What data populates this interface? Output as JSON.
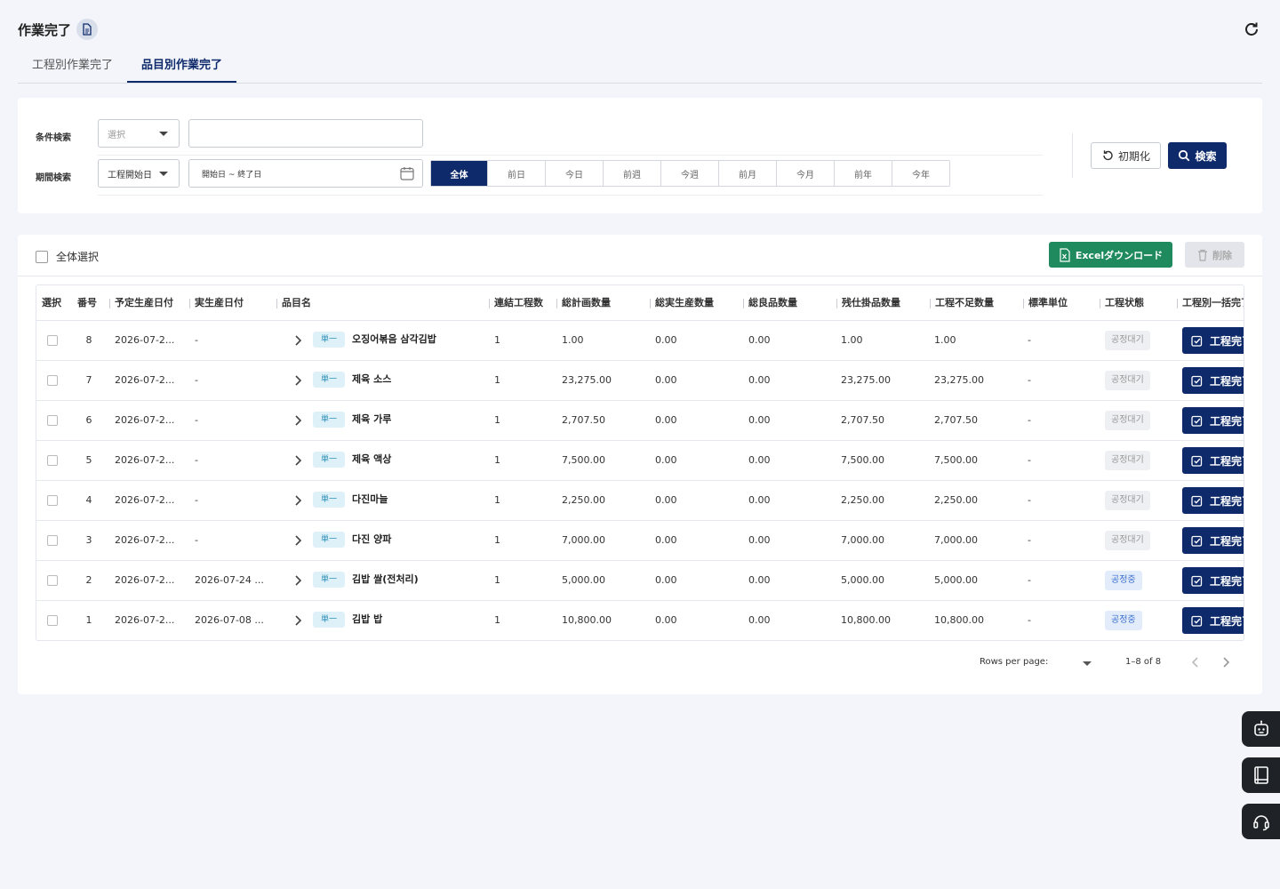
{
  "header": {
    "title": "作業完了"
  },
  "tabs": [
    {
      "label": "工程別作業完了",
      "active": false
    },
    {
      "label": "品目別作業完了",
      "active": true
    }
  ],
  "search": {
    "condition_label": "条件検索",
    "condition_select_placeholder": "選択",
    "condition_input_value": "",
    "period_label": "期間検索",
    "period_select_value": "工程開始日",
    "date_range_placeholder": "開始日 ~ 終了日",
    "period_buttons": [
      "全体",
      "前日",
      "今日",
      "前週",
      "今週",
      "前月",
      "今月",
      "前年",
      "今年"
    ],
    "period_active": "全体",
    "reset_label": "初期化",
    "search_label": "検索"
  },
  "list": {
    "select_all_label": "全体選択",
    "excel_label": "Excelダウンロード",
    "delete_label": "削除",
    "columns": [
      "選択",
      "番号",
      "予定生産日付",
      "実生産日付",
      "品目名",
      "連結工程数",
      "総計画数量",
      "総実生産数量",
      "総良品数量",
      "残仕掛品数量",
      "工程不足数量",
      "標準単位",
      "工程状態",
      "工程別一括完了"
    ],
    "single_tag": "単一",
    "complete_label": "工程完了",
    "rows": [
      {
        "no": "8",
        "planned": "2026-07-2...",
        "actual": "-",
        "item": "오징어볶음 삼각김밥",
        "linked": "1",
        "plan_qty": "1.00",
        "actual_qty": "0.00",
        "good_qty": "0.00",
        "wip_qty": "1.00",
        "short_qty": "1.00",
        "unit": "-",
        "status": "공정대기",
        "status_type": "wait"
      },
      {
        "no": "7",
        "planned": "2026-07-2...",
        "actual": "-",
        "item": "제육 소스",
        "linked": "1",
        "plan_qty": "23,275.00",
        "actual_qty": "0.00",
        "good_qty": "0.00",
        "wip_qty": "23,275.00",
        "short_qty": "23,275.00",
        "unit": "-",
        "status": "공정대기",
        "status_type": "wait"
      },
      {
        "no": "6",
        "planned": "2026-07-2...",
        "actual": "-",
        "item": "제육 가루",
        "linked": "1",
        "plan_qty": "2,707.50",
        "actual_qty": "0.00",
        "good_qty": "0.00",
        "wip_qty": "2,707.50",
        "short_qty": "2,707.50",
        "unit": "-",
        "status": "공정대기",
        "status_type": "wait"
      },
      {
        "no": "5",
        "planned": "2026-07-2...",
        "actual": "-",
        "item": "제육 액상",
        "linked": "1",
        "plan_qty": "7,500.00",
        "actual_qty": "0.00",
        "good_qty": "0.00",
        "wip_qty": "7,500.00",
        "short_qty": "7,500.00",
        "unit": "-",
        "status": "공정대기",
        "status_type": "wait"
      },
      {
        "no": "4",
        "planned": "2026-07-2...",
        "actual": "-",
        "item": "다진마늘",
        "linked": "1",
        "plan_qty": "2,250.00",
        "actual_qty": "0.00",
        "good_qty": "0.00",
        "wip_qty": "2,250.00",
        "short_qty": "2,250.00",
        "unit": "-",
        "status": "공정대기",
        "status_type": "wait"
      },
      {
        "no": "3",
        "planned": "2026-07-2...",
        "actual": "-",
        "item": "다진 양파",
        "linked": "1",
        "plan_qty": "7,000.00",
        "actual_qty": "0.00",
        "good_qty": "0.00",
        "wip_qty": "7,000.00",
        "short_qty": "7,000.00",
        "unit": "-",
        "status": "공정대기",
        "status_type": "wait"
      },
      {
        "no": "2",
        "planned": "2026-07-2...",
        "actual": "2026-07-24 ...",
        "item": "김밥 쌀(전처리)",
        "linked": "1",
        "plan_qty": "5,000.00",
        "actual_qty": "0.00",
        "good_qty": "0.00",
        "wip_qty": "5,000.00",
        "short_qty": "5,000.00",
        "unit": "-",
        "status": "공정중",
        "status_type": "active"
      },
      {
        "no": "1",
        "planned": "2026-07-2...",
        "actual": "2026-07-08 ...",
        "item": "김밥 밥",
        "linked": "1",
        "plan_qty": "10,800.00",
        "actual_qty": "0.00",
        "good_qty": "0.00",
        "wip_qty": "10,800.00",
        "short_qty": "10,800.00",
        "unit": "-",
        "status": "공정중",
        "status_type": "active"
      }
    ]
  },
  "pagination": {
    "rows_per_page_label": "Rows per page:",
    "rows_per_page_value": "",
    "range_text": "1–8 of 8"
  },
  "side_buttons": [
    "robot-icon",
    "book-icon",
    "headset-icon"
  ],
  "colors": {
    "primary": "#0e2a6b",
    "excel": "#1f8a5e",
    "wait_status": "#999999",
    "active_status": "#3b6fd0"
  }
}
